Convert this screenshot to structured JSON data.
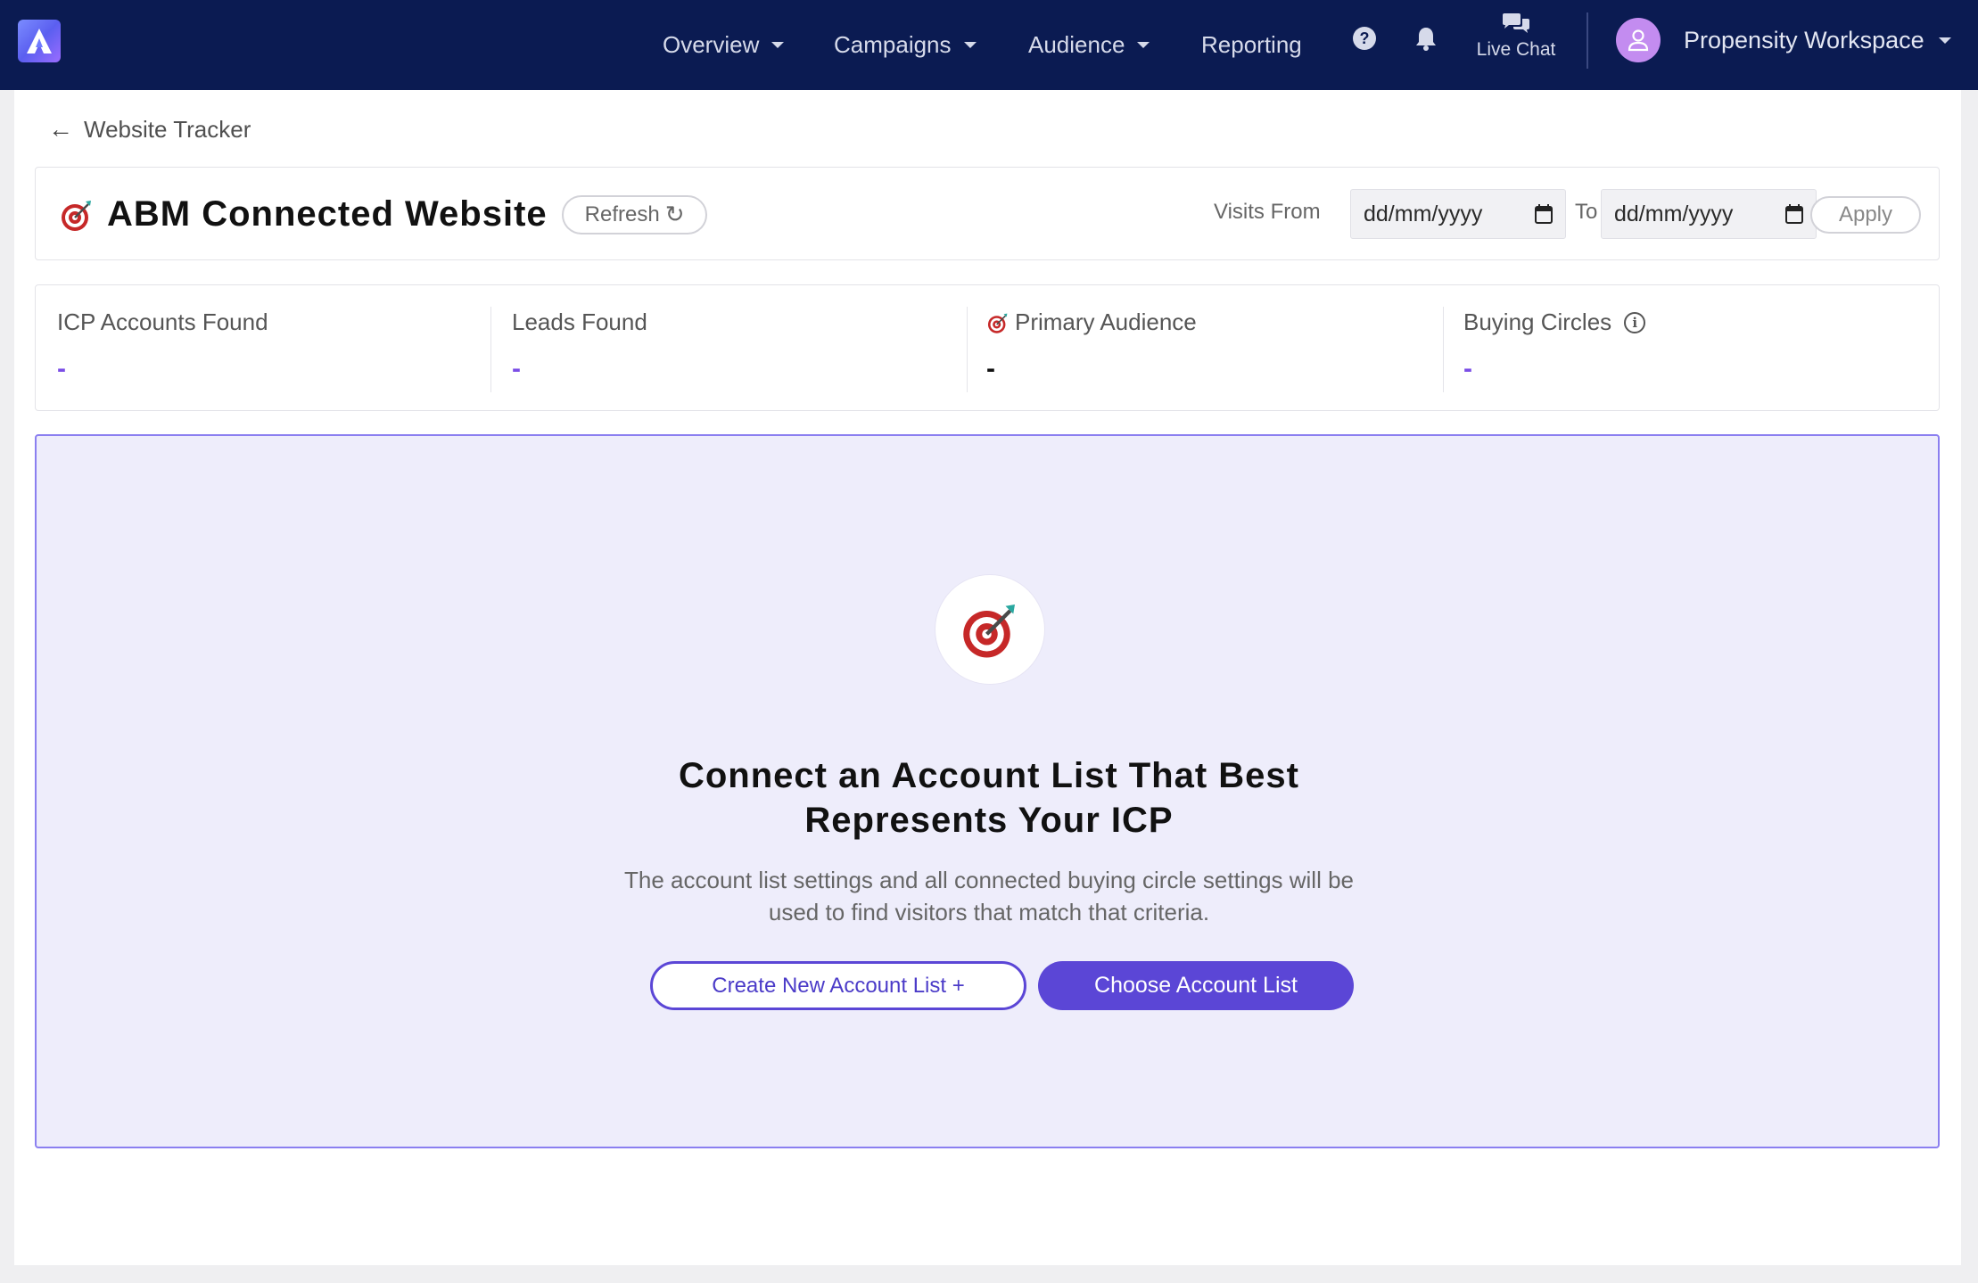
{
  "nav": {
    "logo_icon": "app-logo-icon",
    "items": [
      {
        "label": "Overview",
        "has_caret": true
      },
      {
        "label": "Campaigns",
        "has_caret": true
      },
      {
        "label": "Audience",
        "has_caret": true
      },
      {
        "label": "Reporting",
        "has_caret": false
      }
    ],
    "help_icon": "question-circle-icon",
    "bell_icon": "bell-icon",
    "live_chat_label": "Live Chat",
    "live_chat_icon": "chat-bubbles-icon",
    "avatar_icon": "user-avatar-icon",
    "workspace_label": "Propensity Workspace"
  },
  "breadcrumb": {
    "back_label": "Website Tracker",
    "back_icon": "arrow-left-icon"
  },
  "header": {
    "title": "ABM Connected Website",
    "title_icon": "dart-target-icon",
    "refresh_label": "Refresh",
    "refresh_icon": "refresh-icon",
    "visits_from_label": "Visits From",
    "date_from_placeholder": "dd/mm/yyyy",
    "to_label": "To",
    "date_to_placeholder": "dd/mm/yyyy",
    "calendar_icon": "calendar-icon",
    "apply_label": "Apply"
  },
  "stats": [
    {
      "label": "ICP Accounts Found",
      "value": "-"
    },
    {
      "label": "Leads Found",
      "value": "-"
    },
    {
      "label": "Primary Audience",
      "value": "-"
    },
    {
      "label": "Buying Circles",
      "value": "-"
    }
  ],
  "empty_state": {
    "icon": "dart-target-icon",
    "title_line1": "Connect an Account List That Best",
    "title_line2": "Represents Your ICP",
    "desc_line1": "The account list settings and all connected buying circle settings will be",
    "desc_line2": "used to find visitors that match that criteria.",
    "create_button": "Create New Account List +",
    "choose_button": "Choose Account List"
  },
  "colors": {
    "nav_bg": "#0b1b52",
    "accent": "#5b46d6",
    "stat_value": "#7b4ee6",
    "empty_bg": "#eeedfb",
    "empty_border": "#8b7ff0"
  }
}
